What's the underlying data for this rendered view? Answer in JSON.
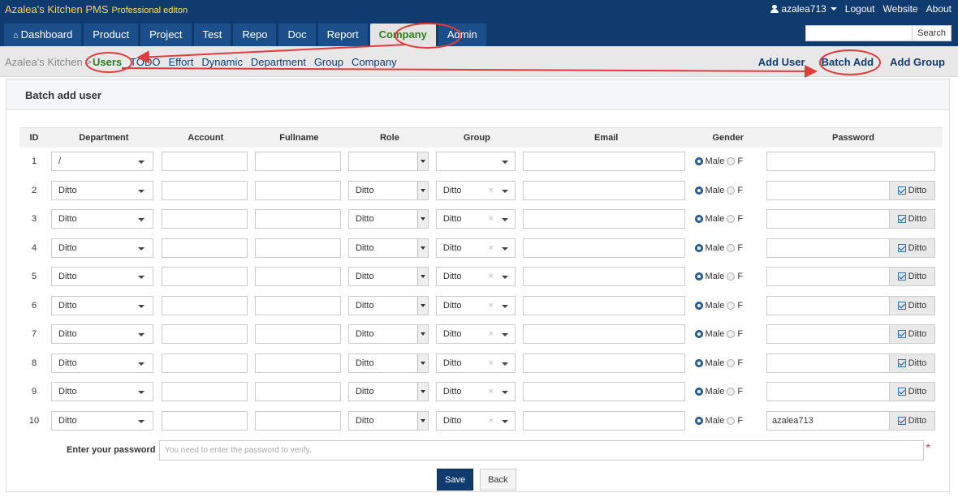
{
  "app": {
    "title": "Azalea's Kitchen PMS",
    "edition": "Professional editon"
  },
  "user_menu": {
    "username": "azalea713",
    "logout": "Logout",
    "website": "Website",
    "about": "About"
  },
  "nav": {
    "tabs": [
      {
        "label": "Dashboard",
        "active": false
      },
      {
        "label": "Product",
        "active": false
      },
      {
        "label": "Project",
        "active": false
      },
      {
        "label": "Test",
        "active": false
      },
      {
        "label": "Repo",
        "active": false
      },
      {
        "label": "Doc",
        "active": false
      },
      {
        "label": "Report",
        "active": false
      },
      {
        "label": "Company",
        "active": true
      },
      {
        "label": "Admin",
        "active": false
      }
    ]
  },
  "search": {
    "placeholder": "",
    "button": "Search"
  },
  "subnav": {
    "crumb": "Azalea's Kitchen",
    "items": [
      "Users",
      "TODO",
      "Effort",
      "Dynamic",
      "Department",
      "Group",
      "Company"
    ],
    "actions": [
      "Add User",
      "Batch Add",
      "Add Group"
    ]
  },
  "panel": {
    "title": "Batch add user"
  },
  "table": {
    "headers": [
      "ID",
      "Department",
      "Account",
      "Fullname",
      "Role",
      "Group",
      "Email",
      "Gender",
      "Password"
    ],
    "rows": [
      {
        "id": "1",
        "department": "/",
        "role": "",
        "group": "",
        "group_clear": false,
        "password": "",
        "ditto": false
      },
      {
        "id": "2",
        "department": "Ditto",
        "role": "Ditto",
        "group": "Ditto",
        "group_clear": true,
        "password": "",
        "ditto": true
      },
      {
        "id": "3",
        "department": "Ditto",
        "role": "Ditto",
        "group": "Ditto",
        "group_clear": true,
        "password": "",
        "ditto": true
      },
      {
        "id": "4",
        "department": "Ditto",
        "role": "Ditto",
        "group": "Ditto",
        "group_clear": true,
        "password": "",
        "ditto": true
      },
      {
        "id": "5",
        "department": "Ditto",
        "role": "Ditto",
        "group": "Ditto",
        "group_clear": true,
        "password": "",
        "ditto": true
      },
      {
        "id": "6",
        "department": "Ditto",
        "role": "Ditto",
        "group": "Ditto",
        "group_clear": true,
        "password": "",
        "ditto": true
      },
      {
        "id": "7",
        "department": "Ditto",
        "role": "Ditto",
        "group": "Ditto",
        "group_clear": true,
        "password": "",
        "ditto": true
      },
      {
        "id": "8",
        "department": "Ditto",
        "role": "Ditto",
        "group": "Ditto",
        "group_clear": true,
        "password": "",
        "ditto": true
      },
      {
        "id": "9",
        "department": "Ditto",
        "role": "Ditto",
        "group": "Ditto",
        "group_clear": true,
        "password": "",
        "ditto": true
      },
      {
        "id": "10",
        "department": "Ditto",
        "role": "Ditto",
        "group": "Ditto",
        "group_clear": true,
        "password": "azalea713",
        "ditto": true
      }
    ],
    "gender_male": "Male",
    "gender_female_truncated": "F",
    "ditto_label": "Ditto",
    "group_clear_glyph": "×"
  },
  "verify": {
    "label": "Enter your password",
    "placeholder": "You need to enter the password to verify.",
    "required_mark": "*"
  },
  "buttons": {
    "save": "Save",
    "back": "Back"
  },
  "colors": {
    "topbar": "#0f3b6e",
    "tab": "#1a4f8b",
    "active_tab_text": "#2e7d1e",
    "annotation": "#e23b3b"
  }
}
